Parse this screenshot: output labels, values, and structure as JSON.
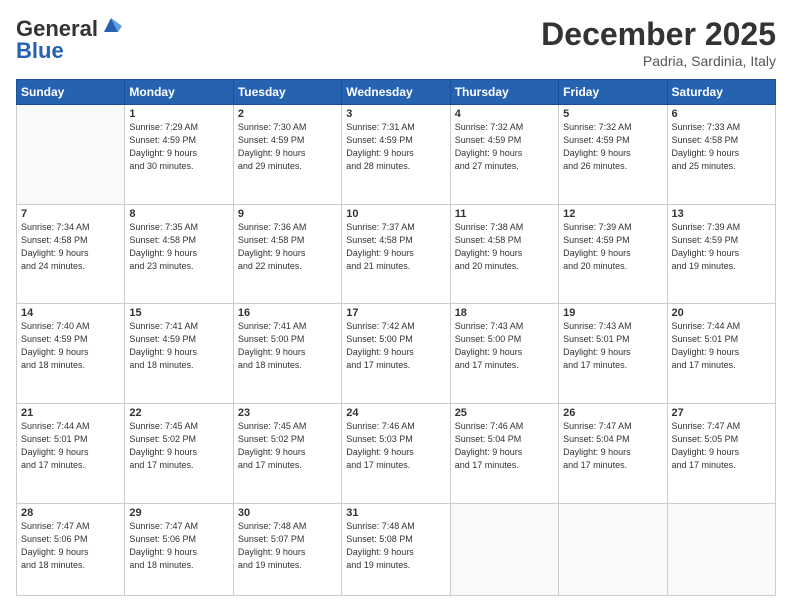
{
  "logo": {
    "line1": "General",
    "line2": "Blue"
  },
  "header": {
    "month": "December 2025",
    "location": "Padria, Sardinia, Italy"
  },
  "weekdays": [
    "Sunday",
    "Monday",
    "Tuesday",
    "Wednesday",
    "Thursday",
    "Friday",
    "Saturday"
  ],
  "weeks": [
    [
      {
        "day": "",
        "info": ""
      },
      {
        "day": "1",
        "info": "Sunrise: 7:29 AM\nSunset: 4:59 PM\nDaylight: 9 hours\nand 30 minutes."
      },
      {
        "day": "2",
        "info": "Sunrise: 7:30 AM\nSunset: 4:59 PM\nDaylight: 9 hours\nand 29 minutes."
      },
      {
        "day": "3",
        "info": "Sunrise: 7:31 AM\nSunset: 4:59 PM\nDaylight: 9 hours\nand 28 minutes."
      },
      {
        "day": "4",
        "info": "Sunrise: 7:32 AM\nSunset: 4:59 PM\nDaylight: 9 hours\nand 27 minutes."
      },
      {
        "day": "5",
        "info": "Sunrise: 7:32 AM\nSunset: 4:59 PM\nDaylight: 9 hours\nand 26 minutes."
      },
      {
        "day": "6",
        "info": "Sunrise: 7:33 AM\nSunset: 4:58 PM\nDaylight: 9 hours\nand 25 minutes."
      }
    ],
    [
      {
        "day": "7",
        "info": "Sunrise: 7:34 AM\nSunset: 4:58 PM\nDaylight: 9 hours\nand 24 minutes."
      },
      {
        "day": "8",
        "info": "Sunrise: 7:35 AM\nSunset: 4:58 PM\nDaylight: 9 hours\nand 23 minutes."
      },
      {
        "day": "9",
        "info": "Sunrise: 7:36 AM\nSunset: 4:58 PM\nDaylight: 9 hours\nand 22 minutes."
      },
      {
        "day": "10",
        "info": "Sunrise: 7:37 AM\nSunset: 4:58 PM\nDaylight: 9 hours\nand 21 minutes."
      },
      {
        "day": "11",
        "info": "Sunrise: 7:38 AM\nSunset: 4:58 PM\nDaylight: 9 hours\nand 20 minutes."
      },
      {
        "day": "12",
        "info": "Sunrise: 7:39 AM\nSunset: 4:59 PM\nDaylight: 9 hours\nand 20 minutes."
      },
      {
        "day": "13",
        "info": "Sunrise: 7:39 AM\nSunset: 4:59 PM\nDaylight: 9 hours\nand 19 minutes."
      }
    ],
    [
      {
        "day": "14",
        "info": "Sunrise: 7:40 AM\nSunset: 4:59 PM\nDaylight: 9 hours\nand 18 minutes."
      },
      {
        "day": "15",
        "info": "Sunrise: 7:41 AM\nSunset: 4:59 PM\nDaylight: 9 hours\nand 18 minutes."
      },
      {
        "day": "16",
        "info": "Sunrise: 7:41 AM\nSunset: 5:00 PM\nDaylight: 9 hours\nand 18 minutes."
      },
      {
        "day": "17",
        "info": "Sunrise: 7:42 AM\nSunset: 5:00 PM\nDaylight: 9 hours\nand 17 minutes."
      },
      {
        "day": "18",
        "info": "Sunrise: 7:43 AM\nSunset: 5:00 PM\nDaylight: 9 hours\nand 17 minutes."
      },
      {
        "day": "19",
        "info": "Sunrise: 7:43 AM\nSunset: 5:01 PM\nDaylight: 9 hours\nand 17 minutes."
      },
      {
        "day": "20",
        "info": "Sunrise: 7:44 AM\nSunset: 5:01 PM\nDaylight: 9 hours\nand 17 minutes."
      }
    ],
    [
      {
        "day": "21",
        "info": "Sunrise: 7:44 AM\nSunset: 5:01 PM\nDaylight: 9 hours\nand 17 minutes."
      },
      {
        "day": "22",
        "info": "Sunrise: 7:45 AM\nSunset: 5:02 PM\nDaylight: 9 hours\nand 17 minutes."
      },
      {
        "day": "23",
        "info": "Sunrise: 7:45 AM\nSunset: 5:02 PM\nDaylight: 9 hours\nand 17 minutes."
      },
      {
        "day": "24",
        "info": "Sunrise: 7:46 AM\nSunset: 5:03 PM\nDaylight: 9 hours\nand 17 minutes."
      },
      {
        "day": "25",
        "info": "Sunrise: 7:46 AM\nSunset: 5:04 PM\nDaylight: 9 hours\nand 17 minutes."
      },
      {
        "day": "26",
        "info": "Sunrise: 7:47 AM\nSunset: 5:04 PM\nDaylight: 9 hours\nand 17 minutes."
      },
      {
        "day": "27",
        "info": "Sunrise: 7:47 AM\nSunset: 5:05 PM\nDaylight: 9 hours\nand 17 minutes."
      }
    ],
    [
      {
        "day": "28",
        "info": "Sunrise: 7:47 AM\nSunset: 5:06 PM\nDaylight: 9 hours\nand 18 minutes."
      },
      {
        "day": "29",
        "info": "Sunrise: 7:47 AM\nSunset: 5:06 PM\nDaylight: 9 hours\nand 18 minutes."
      },
      {
        "day": "30",
        "info": "Sunrise: 7:48 AM\nSunset: 5:07 PM\nDaylight: 9 hours\nand 19 minutes."
      },
      {
        "day": "31",
        "info": "Sunrise: 7:48 AM\nSunset: 5:08 PM\nDaylight: 9 hours\nand 19 minutes."
      },
      {
        "day": "",
        "info": ""
      },
      {
        "day": "",
        "info": ""
      },
      {
        "day": "",
        "info": ""
      }
    ]
  ]
}
